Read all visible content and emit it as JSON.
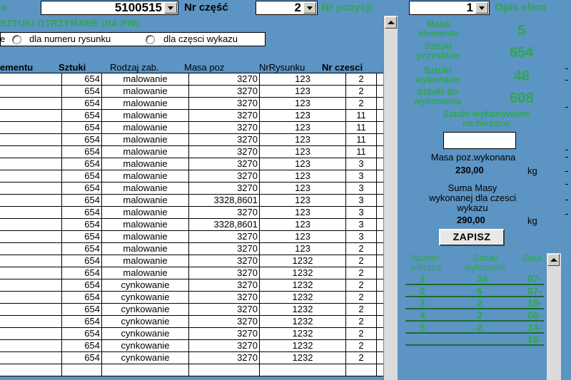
{
  "topbar": {
    "left_fragment": "a",
    "order_number": "5100515",
    "part_label": "Nr część",
    "part_value": "2",
    "position_label": "Nr pozycji",
    "position_value": "1",
    "description_label": "Opis elem"
  },
  "left": {
    "section_title": "SZTUKI OTRZYMANE (NA PW)",
    "radio_first_fragment": "e",
    "radio_drawing": "dla numeru rysunku",
    "radio_part": "dla częsci wykazu",
    "columns": [
      "ementu",
      "Sztuki",
      "Rodzaj zab.",
      "Masa poz",
      "NrRysunku",
      "Nr czesci"
    ],
    "rows": [
      [
        "",
        "654",
        "malowanie",
        "3270",
        "123",
        "2"
      ],
      [
        "",
        "654",
        "malowanie",
        "3270",
        "123",
        "2"
      ],
      [
        "",
        "654",
        "malowanie",
        "3270",
        "123",
        "2"
      ],
      [
        "",
        "654",
        "malowanie",
        "3270",
        "123",
        "11"
      ],
      [
        "",
        "654",
        "malowanie",
        "3270",
        "123",
        "11"
      ],
      [
        "",
        "654",
        "malowanie",
        "3270",
        "123",
        "11"
      ],
      [
        "",
        "654",
        "malowanie",
        "3270",
        "123",
        "11"
      ],
      [
        "",
        "654",
        "malowanie",
        "3270",
        "123",
        "3"
      ],
      [
        "",
        "654",
        "malowanie",
        "3270",
        "123",
        "3"
      ],
      [
        "",
        "654",
        "malowanie",
        "3270",
        "123",
        "3"
      ],
      [
        "",
        "654",
        "malowanie",
        "3328,8601",
        "123",
        "3"
      ],
      [
        "",
        "654",
        "malowanie",
        "3270",
        "123",
        "3"
      ],
      [
        "",
        "654",
        "malowanie",
        "3328,8601",
        "123",
        "3"
      ],
      [
        "",
        "654",
        "malowanie",
        "3270",
        "123",
        "3"
      ],
      [
        "",
        "654",
        "malowanie",
        "3270",
        "123",
        "2"
      ],
      [
        "",
        "654",
        "malowanie",
        "3270",
        "1232",
        "2"
      ],
      [
        "",
        "654",
        "malowanie",
        "3270",
        "1232",
        "2"
      ],
      [
        "",
        "654",
        "cynkowanie",
        "3270",
        "1232",
        "2"
      ],
      [
        "",
        "654",
        "cynkowanie",
        "3270",
        "1232",
        "2"
      ],
      [
        "",
        "654",
        "cynkowanie",
        "3270",
        "1232",
        "2"
      ],
      [
        "",
        "654",
        "cynkowanie",
        "3270",
        "1232",
        "2"
      ],
      [
        "",
        "654",
        "cynkowanie",
        "3270",
        "1232",
        "2"
      ],
      [
        "",
        "654",
        "cynkowanie",
        "3270",
        "1232",
        "2"
      ],
      [
        "",
        "654",
        "cynkowanie",
        "3270",
        "1232",
        "2"
      ],
      [
        "",
        "",
        "",
        "",
        "",
        ""
      ]
    ]
  },
  "right": {
    "masa_label": "Masa\nelementu",
    "masa_value": "5",
    "przyslane_label": "Sztuki\nprzysłane",
    "przyslane_value": "654",
    "wykonane_label": "Sztuki\nwykonane",
    "wykonane_value": "46",
    "do_wykonania_label": "Sztuki do\nwykonania",
    "do_wykonania_value": "608",
    "biezace_label": "Sztuki wykonywane\nna bieżąco",
    "masa_wyk_label": "Masa poz.wykonana",
    "masa_wyk_value": "230,00",
    "kg1": "kg",
    "suma_label": "Suma Masy\nwykonanej dla czesci\nwykazu",
    "suma_value": "290,00",
    "kg2": "kg",
    "save_label": "ZAPISZ",
    "sub_headers": [
      "Numer\nwiersza",
      "Sztuki\nwykonane",
      "Data"
    ],
    "sub_rows": [
      [
        "1",
        "34",
        "07-"
      ],
      [
        "2",
        "6",
        "07-"
      ],
      [
        "3",
        "2",
        "18-"
      ],
      [
        "4",
        "2",
        "06-"
      ],
      [
        "5",
        "2",
        "14-"
      ],
      [
        "",
        "",
        "18-"
      ]
    ]
  }
}
